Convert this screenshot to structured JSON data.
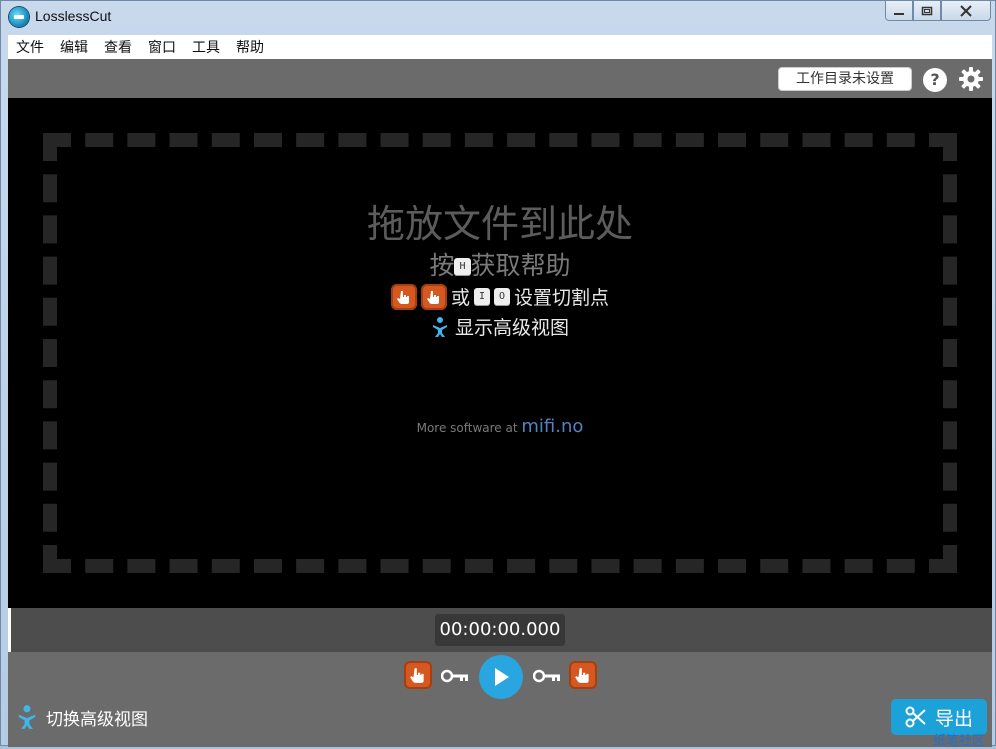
{
  "window": {
    "title": "LosslessCut",
    "min_label": "—",
    "max_label": "▭",
    "close_label": "✕"
  },
  "menu": [
    "文件",
    "编辑",
    "查看",
    "窗口",
    "工具",
    "帮助"
  ],
  "toolbar": {
    "workdir_label": "工作目录未设置",
    "help_label": "?"
  },
  "player": {
    "drop_title": "拖放文件到此处",
    "help_prefix": "按",
    "help_key": "H",
    "help_suffix": "获取帮助",
    "cut_or": "或",
    "cut_key_in": "I",
    "cut_key_out": "O",
    "cut_suffix": "设置切割点",
    "advanced_label": "显示高级视图",
    "more_prefix": "More software at",
    "more_link": "mifi.no"
  },
  "timeline": {
    "timecode": "00:00:00.000"
  },
  "controls": {
    "toggle_advanced_label": "切换高级视图",
    "export_label": "导出"
  },
  "watermark": "纸笔社区",
  "colors": {
    "accent": "#1ca2d8",
    "cut_orange": "#d4581f",
    "background": "#6b6b6b",
    "video_bg": "#000000"
  }
}
